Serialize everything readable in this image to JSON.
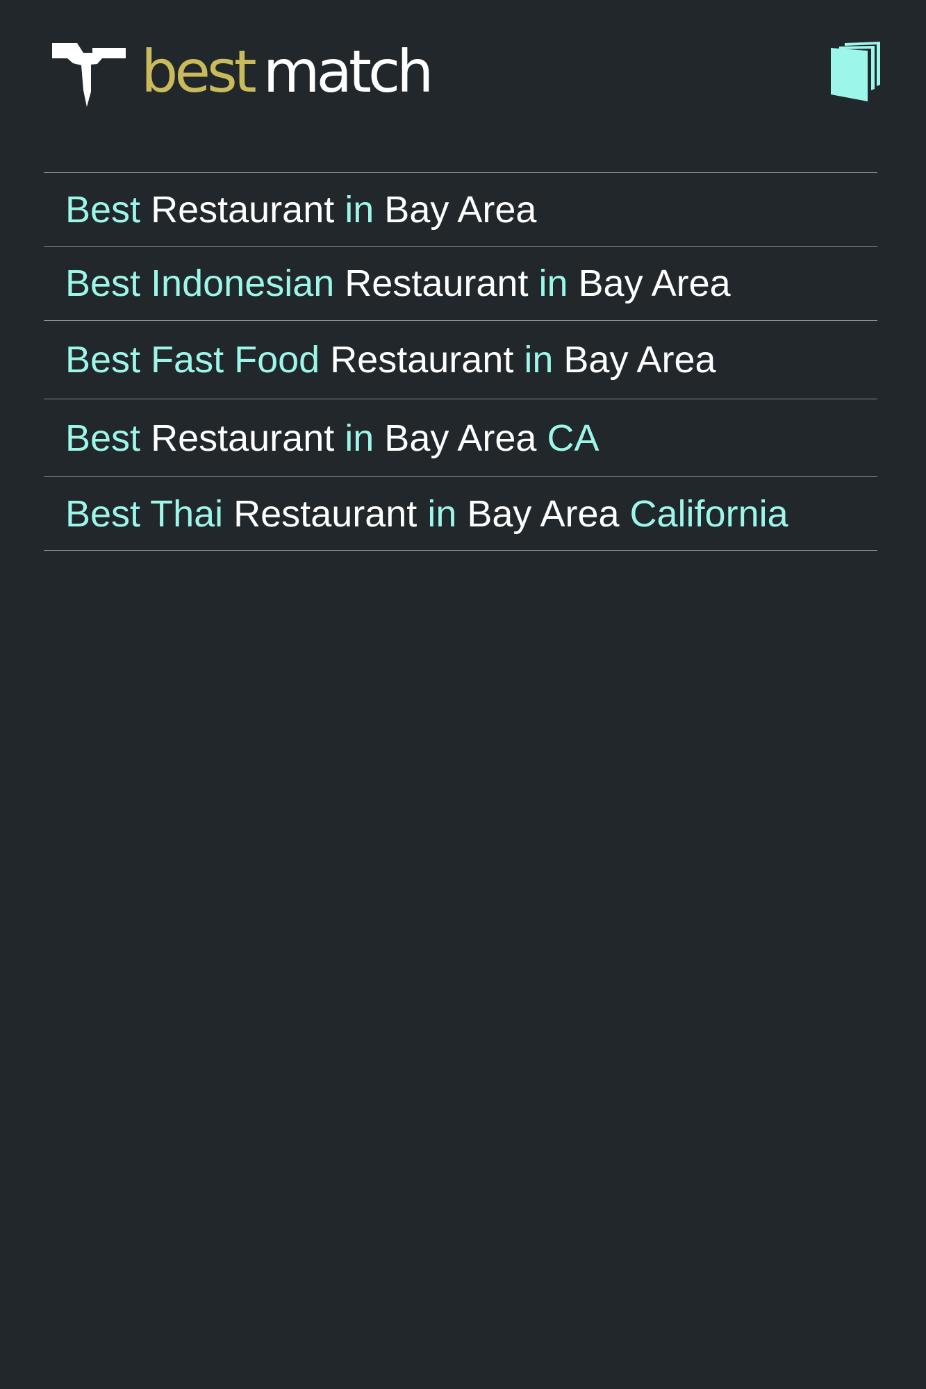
{
  "header": {
    "wordmark_best": "best",
    "wordmark_match": "match"
  },
  "colors": {
    "background": "#21272a",
    "highlight": "#9df6ea",
    "wordmark_accent": "#c9bb5c",
    "text": "#ffffff"
  },
  "icons": {
    "logo": "bestmatch-logo-mark",
    "menu": "book-menu-icon"
  },
  "list": {
    "items": [
      {
        "segments": [
          {
            "text": "Best",
            "highlight": true
          },
          {
            "text": "Restaurant",
            "highlight": false
          },
          {
            "text": "in",
            "highlight": true
          },
          {
            "text": "Bay Area",
            "highlight": false
          }
        ]
      },
      {
        "segments": [
          {
            "text": "Best Indonesian",
            "highlight": true
          },
          {
            "text": "Restaurant",
            "highlight": false
          },
          {
            "text": "in",
            "highlight": true
          },
          {
            "text": "Bay Area",
            "highlight": false
          }
        ]
      },
      {
        "segments": [
          {
            "text": "Best Fast Food",
            "highlight": true
          },
          {
            "text": "Restaurant",
            "highlight": false
          },
          {
            "text": "in",
            "highlight": true
          },
          {
            "text": "Bay Area",
            "highlight": false
          }
        ]
      },
      {
        "segments": [
          {
            "text": "Best",
            "highlight": true
          },
          {
            "text": "Restaurant",
            "highlight": false
          },
          {
            "text": "in",
            "highlight": true
          },
          {
            "text": "Bay Area",
            "highlight": false
          },
          {
            "text": "CA",
            "highlight": true
          }
        ]
      },
      {
        "segments": [
          {
            "text": "Best Thai",
            "highlight": true
          },
          {
            "text": "Restaurant",
            "highlight": false
          },
          {
            "text": "in",
            "highlight": true
          },
          {
            "text": "Bay Area",
            "highlight": false
          },
          {
            "text": "California",
            "highlight": true
          }
        ]
      }
    ]
  }
}
